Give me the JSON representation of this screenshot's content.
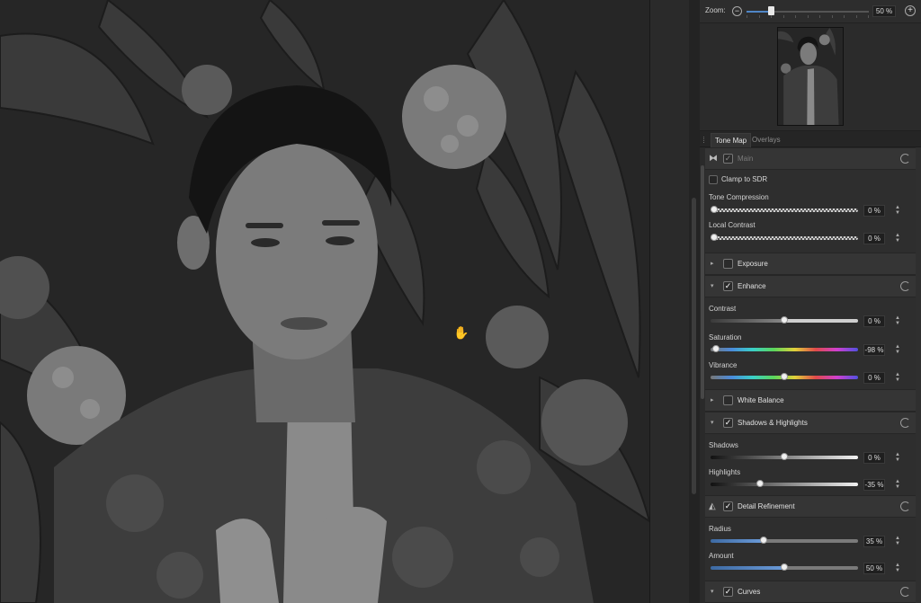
{
  "zoom": {
    "label": "Zoom:",
    "value": "50 %",
    "level_fraction": 0.2,
    "minus_icon": "zoom-out-icon",
    "plus_icon": "zoom-in-icon"
  },
  "tabs": [
    {
      "label": "Tone Map",
      "active": true
    },
    {
      "label": "Overlays",
      "active": false
    }
  ],
  "main": {
    "title": "Main",
    "clamp_label": "Clamp to SDR",
    "checked": true
  },
  "tone_compression": {
    "label": "Tone Compression",
    "value": "0 %",
    "fraction": 0.0
  },
  "local_contrast": {
    "label": "Local Contrast",
    "value": "0 %",
    "fraction": 0.0
  },
  "exposure": {
    "title": "Exposure",
    "checked": false
  },
  "enhance": {
    "title": "Enhance",
    "checked": true,
    "contrast": {
      "label": "Contrast",
      "value": "0 %",
      "fraction": 0.5
    },
    "saturation": {
      "label": "Saturation",
      "value": "-98 %",
      "fraction": 0.01
    },
    "vibrance": {
      "label": "Vibrance",
      "value": "0 %",
      "fraction": 0.5
    }
  },
  "white_balance": {
    "title": "White Balance",
    "checked": false
  },
  "shadows_highlights": {
    "title": "Shadows & Highlights",
    "checked": true,
    "shadows": {
      "label": "Shadows",
      "value": "0 %",
      "fraction": 0.5
    },
    "highlights": {
      "label": "Highlights",
      "value": "-35 %",
      "fraction": 0.33
    }
  },
  "detail_refinement": {
    "title": "Detail Refinement",
    "checked": true,
    "radius": {
      "label": "Radius",
      "value": "35 %",
      "fraction": 0.35
    },
    "amount": {
      "label": "Amount",
      "value": "50 %",
      "fraction": 0.5
    }
  },
  "curves": {
    "title": "Curves",
    "checked": true
  },
  "colors": {
    "accent": "#5b8fd0",
    "panel_bg": "#2f2f2f",
    "section_bg": "#353535"
  }
}
